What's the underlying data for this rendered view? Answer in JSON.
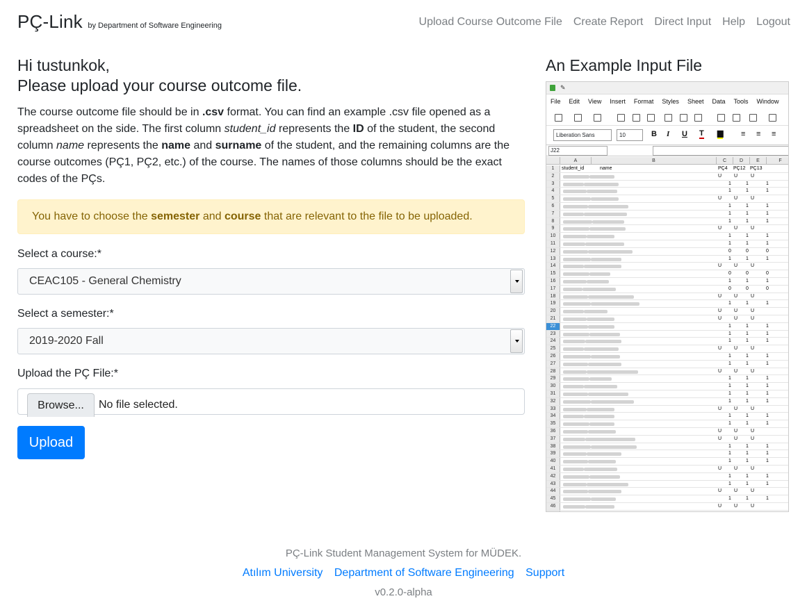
{
  "navbar": {
    "brand": "PÇ-Link",
    "brand_sub": "by Department of Software Engineering",
    "links": [
      "Upload Course Outcome File",
      "Create Report",
      "Direct Input",
      "Help",
      "Logout"
    ]
  },
  "main": {
    "greeting_line1": "Hi tustunkok,",
    "greeting_line2": "Please upload your course outcome file.",
    "desc": {
      "p1": "The course outcome file should be in ",
      "b1": ".csv",
      "p2": " format. You can find an example .csv file opened as a spreadsheet on the side. The first column ",
      "i1": "student_id",
      "p3": " represents the ",
      "b2": "ID",
      "p4": " of the student, the second column ",
      "i2": "name",
      "p5": " represents the ",
      "b3": "name",
      "p6": " and ",
      "b4": "surname",
      "p7": " of the student, and the remaining columns are the course outcomes (PÇ1, PÇ2, etc.) of the course. The names of those columns should be the exact codes of the PÇs."
    },
    "alert": {
      "t1": "You have to choose the ",
      "b1": "semester",
      "t2": " and ",
      "b2": "course",
      "t3": " that are relevant to the file to be uploaded."
    },
    "course_label": "Select a course:*",
    "course_value": "CEAC105 - General Chemistry",
    "semester_label": "Select a semester:*",
    "semester_value": "2019-2020 Fall",
    "file_label": "Upload the PÇ File:*",
    "browse_label": "Browse...",
    "file_status": "No file selected.",
    "upload_label": "Upload"
  },
  "example": {
    "title": "An Example Input File",
    "menu": [
      "File",
      "Edit",
      "View",
      "Insert",
      "Format",
      "Styles",
      "Sheet",
      "Data",
      "Tools",
      "Window"
    ],
    "font_name": "Liberation Sans",
    "font_size": "10",
    "cell_ref": "J22",
    "columns": [
      "A",
      "B",
      "C",
      "D",
      "E",
      "F"
    ],
    "header_row": [
      "student_id",
      "name",
      "PÇ4",
      "PÇ12",
      "PÇ13"
    ],
    "selected_row": 22,
    "rows": [
      [
        "U",
        "U",
        "U"
      ],
      [
        "1",
        "1",
        "1"
      ],
      [
        "1",
        "1",
        "1"
      ],
      [
        "U",
        "U",
        "U"
      ],
      [
        "1",
        "1",
        "1"
      ],
      [
        "1",
        "1",
        "1"
      ],
      [
        "1",
        "1",
        "1"
      ],
      [
        "U",
        "U",
        "U"
      ],
      [
        "1",
        "1",
        "1"
      ],
      [
        "1",
        "1",
        "1"
      ],
      [
        "0",
        "0",
        "0"
      ],
      [
        "1",
        "1",
        "1"
      ],
      [
        "U",
        "U",
        "U"
      ],
      [
        "0",
        "0",
        "0"
      ],
      [
        "1",
        "1",
        "1"
      ],
      [
        "0",
        "0",
        "0"
      ],
      [
        "U",
        "U",
        "U"
      ],
      [
        "1",
        "1",
        "1"
      ],
      [
        "U",
        "U",
        "U"
      ],
      [
        "U",
        "U",
        "U"
      ],
      [
        "1",
        "1",
        "1"
      ],
      [
        "1",
        "1",
        "1"
      ],
      [
        "1",
        "1",
        "1"
      ],
      [
        "U",
        "U",
        "U"
      ],
      [
        "1",
        "1",
        "1"
      ],
      [
        "1",
        "1",
        "1"
      ],
      [
        "U",
        "U",
        "U"
      ],
      [
        "1",
        "1",
        "1"
      ],
      [
        "1",
        "1",
        "1"
      ],
      [
        "1",
        "1",
        "1"
      ],
      [
        "1",
        "1",
        "1"
      ],
      [
        "U",
        "U",
        "U"
      ],
      [
        "1",
        "1",
        "1"
      ],
      [
        "1",
        "1",
        "1"
      ],
      [
        "U",
        "U",
        "U"
      ],
      [
        "U",
        "U",
        "U"
      ],
      [
        "1",
        "1",
        "1"
      ],
      [
        "1",
        "1",
        "1"
      ],
      [
        "1",
        "1",
        "1"
      ],
      [
        "U",
        "U",
        "U"
      ],
      [
        "1",
        "1",
        "1"
      ],
      [
        "1",
        "1",
        "1"
      ],
      [
        "U",
        "U",
        "U"
      ],
      [
        "1",
        "1",
        "1"
      ],
      [
        "U",
        "U",
        "U"
      ],
      [
        "U",
        "U",
        "U"
      ]
    ]
  },
  "footer": {
    "line1": "PÇ-Link Student Management System for MÜDEK.",
    "links": [
      "Atılım University",
      "Department of Software Engineering",
      "Support"
    ],
    "version": "v0.2.0-alpha"
  }
}
